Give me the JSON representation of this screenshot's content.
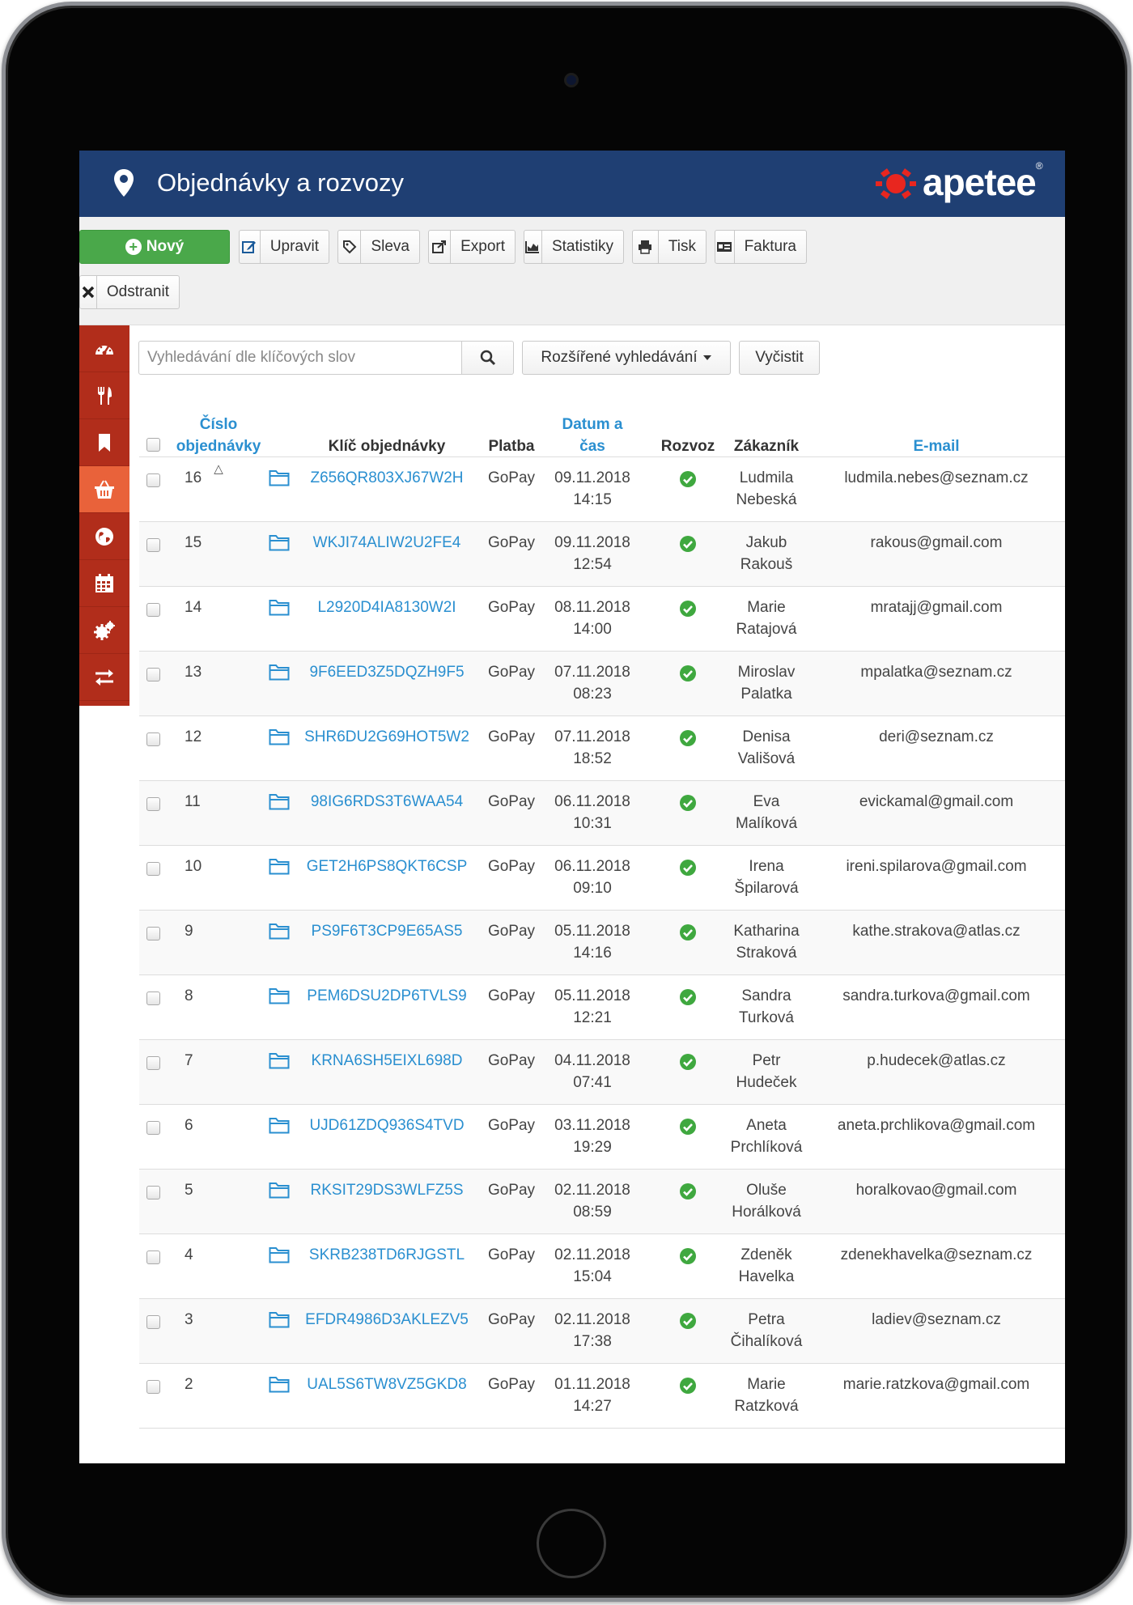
{
  "header": {
    "title": "Objednávky a rozvozy",
    "logo_text": "apetee",
    "logo_reg": "®"
  },
  "toolbar": {
    "new": "Nový",
    "edit": "Upravit",
    "discount": "Sleva",
    "export": "Export",
    "stats": "Statistiky",
    "print": "Tisk",
    "invoice": "Faktura",
    "delete": "Odstranit"
  },
  "sidebar": {
    "items": [
      "dashboard-icon",
      "restaurant-icon",
      "bookmark-icon",
      "basket-icon",
      "globe-icon",
      "calendar-icon",
      "settings-icon",
      "transfer-icon"
    ],
    "active_index": 3
  },
  "search": {
    "placeholder": "Vyhledávání dle klíčových slov",
    "advanced": "Rozšířené vyhledávání",
    "clear": "Vyčistit"
  },
  "table": {
    "headers": {
      "number_line1": "Číslo",
      "number_line2": "objednávky",
      "key": "Klíč objednávky",
      "payment": "Platba",
      "date_line1": "Datum a",
      "date_line2": "čas",
      "delivery": "Rozvoz",
      "customer": "Zákazník",
      "email": "E-mail"
    },
    "sort_indicator": "△",
    "rows": [
      {
        "num": "16",
        "key": "Z656QR803XJ67W2H",
        "pay": "GoPay",
        "date": "09.11.2018",
        "time": "14:15",
        "first": "Ludmila",
        "last": "Nebeská",
        "email": "ludmila.nebes@seznam.cz"
      },
      {
        "num": "15",
        "key": "WKJI74ALIW2U2FE4",
        "pay": "GoPay",
        "date": "09.11.2018",
        "time": "12:54",
        "first": "Jakub",
        "last": "Rakouš",
        "email": "rakous@gmail.com"
      },
      {
        "num": "14",
        "key": "L2920D4IA8130W2I",
        "pay": "GoPay",
        "date": "08.11.2018",
        "time": "14:00",
        "first": "Marie",
        "last": "Ratajová",
        "email": "mratajj@gmail.com"
      },
      {
        "num": "13",
        "key": "9F6EED3Z5DQZH9F5",
        "pay": "GoPay",
        "date": "07.11.2018",
        "time": "08:23",
        "first": "Miroslav",
        "last": "Palatka",
        "email": "mpalatka@seznam.cz"
      },
      {
        "num": "12",
        "key": "SHR6DU2G69HOT5W2",
        "pay": "GoPay",
        "date": "07.11.2018",
        "time": "18:52",
        "first": "Denisa",
        "last": "Vališová",
        "email": "deri@seznam.cz"
      },
      {
        "num": "11",
        "key": "98IG6RDS3T6WAA54",
        "pay": "GoPay",
        "date": "06.11.2018",
        "time": "10:31",
        "first": "Eva",
        "last": "Malíková",
        "email": "evickamal@gmail.com"
      },
      {
        "num": "10",
        "key": "GET2H6PS8QKT6CSP",
        "pay": "GoPay",
        "date": "06.11.2018",
        "time": "09:10",
        "first": "Irena",
        "last": "Špilarová",
        "email": "ireni.spilarova@gmail.com"
      },
      {
        "num": "9",
        "key": "PS9F6T3CP9E65AS5",
        "pay": "GoPay",
        "date": "05.11.2018",
        "time": "14:16",
        "first": "Katharina",
        "last": "Straková",
        "email": "kathe.strakova@atlas.cz"
      },
      {
        "num": "8",
        "key": "PEM6DSU2DP6TVLS9",
        "pay": "GoPay",
        "date": "05.11.2018",
        "time": "12:21",
        "first": "Sandra",
        "last": "Turková",
        "email": "sandra.turkova@gmail.com"
      },
      {
        "num": "7",
        "key": "KRNA6SH5EIXL698D",
        "pay": "GoPay",
        "date": "04.11.2018",
        "time": "07:41",
        "first": "Petr",
        "last": "Hudeček",
        "email": "p.hudecek@atlas.cz"
      },
      {
        "num": "6",
        "key": "UJD61ZDQ936S4TVD",
        "pay": "GoPay",
        "date": "03.11.2018",
        "time": "19:29",
        "first": "Aneta",
        "last": "Prchlíková",
        "email": "aneta.prchlikova@gmail.com"
      },
      {
        "num": "5",
        "key": "RKSIT29DS3WLFZ5S",
        "pay": "GoPay",
        "date": "02.11.2018",
        "time": "08:59",
        "first": "Oluše",
        "last": "Horálková",
        "email": "horalkovao@gmail.com"
      },
      {
        "num": "4",
        "key": "SKRB238TD6RJGSTL",
        "pay": "GoPay",
        "date": "02.11.2018",
        "time": "15:04",
        "first": "Zdeněk",
        "last": "Havelka",
        "email": "zdenekhavelka@seznam.cz"
      },
      {
        "num": "3",
        "key": "EFDR4986D3AKLEZV5",
        "pay": "GoPay",
        "date": "02.11.2018",
        "time": "17:38",
        "first": "Petra",
        "last": "Čihalíková",
        "email": "ladiev@seznam.cz"
      },
      {
        "num": "2",
        "key": "UAL5S6TW8VZ5GKD8",
        "pay": "GoPay",
        "date": "01.11.2018",
        "time": "14:27",
        "first": "Marie",
        "last": "Ratzková",
        "email": "marie.ratzkova@gmail.com"
      }
    ]
  },
  "colors": {
    "header_bg": "#1f3f73",
    "sidebar_bg": "#b12d1b",
    "sidebar_active": "#e9623a",
    "new_button": "#4aa84a",
    "link": "#2a8fd0",
    "delivery_ok": "#3fa83f",
    "logo_red": "#e8261f"
  }
}
